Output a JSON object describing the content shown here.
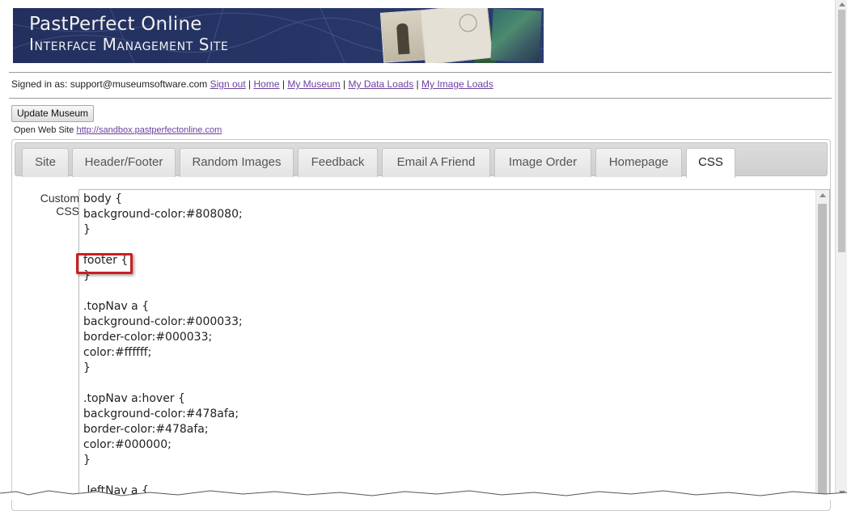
{
  "banner": {
    "title": "PastPerfect Online",
    "subtitle": "Interface Management Site"
  },
  "signin": {
    "prefix": "Signed in as: support@museumsoftware.com",
    "links": [
      "Sign out",
      "Home",
      "My Museum",
      "My Data Loads",
      "My Image Loads"
    ]
  },
  "actions": {
    "update_label": "Update Museum"
  },
  "open_site": {
    "label": "Open Web Site",
    "url": "http://sandbox.pastperfectonline.com"
  },
  "tabs": [
    {
      "label": "Site"
    },
    {
      "label": "Header/Footer"
    },
    {
      "label": "Random Images"
    },
    {
      "label": "Feedback"
    },
    {
      "label": "Email A Friend"
    },
    {
      "label": "Image Order"
    },
    {
      "label": "Homepage"
    },
    {
      "label": "CSS",
      "active": true
    }
  ],
  "editor": {
    "label_line1": "Custom",
    "label_line2": "CSS",
    "lines": [
      "body {",
      "background-color:#808080;",
      "}",
      "",
      "footer {",
      "}",
      "",
      ".topNav a {",
      "background-color:#000033;",
      "border-color:#000033;",
      "color:#ffffff;",
      "}",
      "",
      ".topNav a:hover {",
      "background-color:#478afa;",
      "border-color:#478afa;",
      "color:#000000;",
      "}",
      "",
      ".leftNav a {"
    ]
  },
  "colors": {
    "banner_bg": "#23305f",
    "link": "#6b3fa0",
    "highlight": "#cc1f1f"
  }
}
